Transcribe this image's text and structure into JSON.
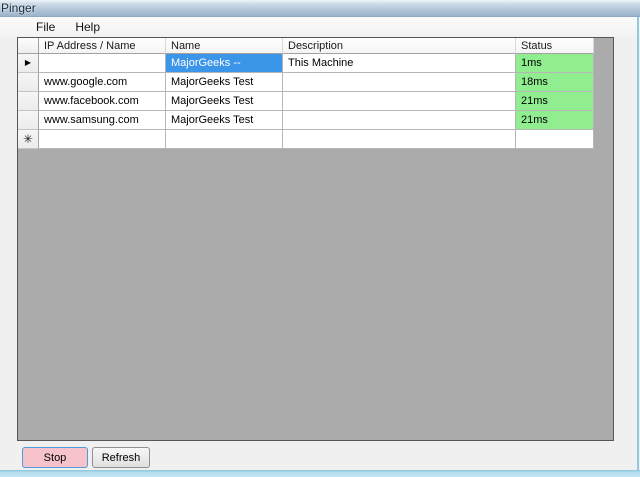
{
  "window": {
    "title": "Pinger"
  },
  "menu": {
    "items": [
      {
        "label": "File"
      },
      {
        "label": "Help"
      }
    ]
  },
  "grid": {
    "columns": [
      "IP Address / Name",
      "Name",
      "Description",
      "Status"
    ],
    "rows": [
      {
        "marker": "current",
        "ip": "",
        "name": "MajorGeeks --",
        "description": "This Machine",
        "status": "1ms",
        "selected_cell": "name",
        "status_ok": true
      },
      {
        "marker": "",
        "ip": "www.google.com",
        "name": "MajorGeeks Test",
        "description": "",
        "status": "18ms",
        "selected_cell": "",
        "status_ok": true
      },
      {
        "marker": "",
        "ip": "www.facebook.com",
        "name": "MajorGeeks Test",
        "description": "",
        "status": "21ms",
        "selected_cell": "",
        "status_ok": true
      },
      {
        "marker": "",
        "ip": "www.samsung.com",
        "name": "MajorGeeks Test",
        "description": "",
        "status": "21ms",
        "selected_cell": "",
        "status_ok": true
      },
      {
        "marker": "new",
        "ip": "",
        "name": "",
        "description": "",
        "status": "",
        "selected_cell": "",
        "status_ok": false
      }
    ]
  },
  "buttons": {
    "stop": "Stop",
    "refresh": "Refresh"
  },
  "icons": {
    "current": "▶",
    "new": "✳"
  },
  "colors": {
    "status_ok": "#90ee90",
    "selection": "#3b95e9",
    "selection_text": "#ffffff",
    "stop_fill": "#f6c2cb",
    "stop_border": "#4f9cd8",
    "grid_background": "#ababab"
  }
}
